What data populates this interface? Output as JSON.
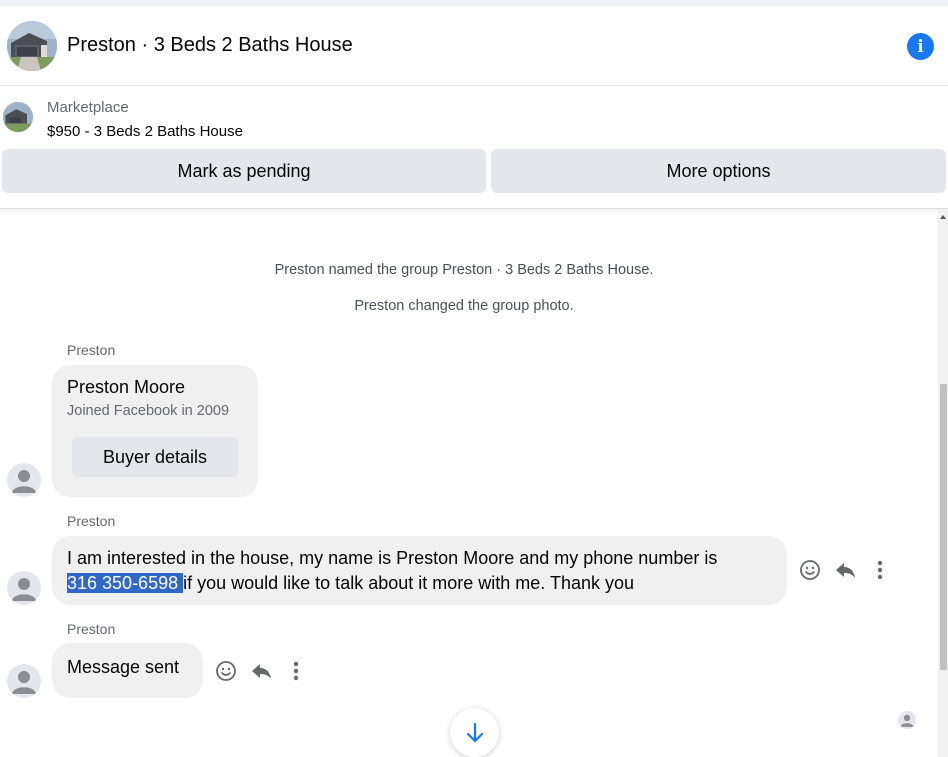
{
  "header": {
    "title": "Preston · 3 Beds 2 Baths House",
    "avatar_icon": "house-photo",
    "info_icon": "info-icon",
    "info_glyph": "i",
    "accent_color": "#1877f2"
  },
  "listing": {
    "source": "Marketplace",
    "title": "$950 - 3 Beds 2 Baths House",
    "buttons": {
      "mark_pending": "Mark as pending",
      "more_options": "More options"
    }
  },
  "conversation": {
    "system_messages": [
      "Preston named the group Preston · 3 Beds 2 Baths House.",
      "Preston changed the group photo."
    ],
    "profile_card": {
      "sender": "Preston",
      "name": "Preston Moore",
      "subtitle": "Joined Facebook in 2009",
      "button": "Buyer details"
    },
    "message_1": {
      "sender": "Preston",
      "text_line1": "I am interested in the house, my name is Preston Moore and my phone number is",
      "phone_highlighted": "316 350-6598 ",
      "text_line2_rest": "if you would like to talk about it more with me. Thank you"
    },
    "message_2": {
      "sender": "Preston",
      "text": "Message sent"
    },
    "message_actions": [
      "react-icon",
      "reply-icon",
      "more-icon"
    ]
  }
}
